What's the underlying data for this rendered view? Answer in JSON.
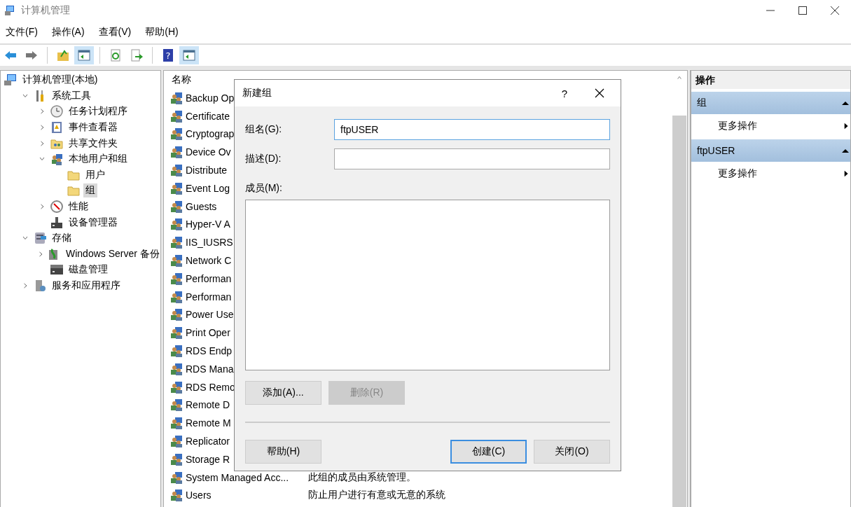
{
  "window": {
    "title": "计算机管理"
  },
  "menu": [
    "文件(F)",
    "操作(A)",
    "查看(V)",
    "帮助(H)"
  ],
  "toolbar": [
    {
      "kind": "back",
      "pressed": false,
      "disabled": false
    },
    {
      "kind": "forward",
      "pressed": false,
      "disabled": true
    },
    {
      "kind": "up",
      "pressed": false,
      "disabled": false
    },
    {
      "kind": "tree",
      "pressed": true,
      "disabled": false
    },
    {
      "kind": "refresh",
      "pressed": false,
      "disabled": false
    },
    {
      "kind": "export",
      "pressed": false,
      "disabled": false
    },
    {
      "kind": "help",
      "pressed": false,
      "disabled": false,
      "glyph": "?"
    },
    {
      "kind": "actions",
      "pressed": true,
      "disabled": false
    }
  ],
  "tree": [
    {
      "label": "计算机管理(本地)",
      "selected": false,
      "children": [
        {
          "label": "系统工具",
          "expanded": true,
          "selected": false,
          "children": [
            {
              "label": "任务计划程序",
              "expanded": false,
              "selected": false
            },
            {
              "label": "事件查看器",
              "expanded": false,
              "selected": false
            },
            {
              "label": "共享文件夹",
              "expanded": false,
              "selected": false
            },
            {
              "label": "本地用户和组",
              "expanded": true,
              "selected": false,
              "children": [
                {
                  "label": "用户",
                  "selected": false
                },
                {
                  "label": "组",
                  "selected": true
                }
              ]
            },
            {
              "label": "性能",
              "expanded": false,
              "selected": false
            },
            {
              "label": "设备管理器",
              "selected": false
            }
          ]
        },
        {
          "label": "存储",
          "expanded": true,
          "selected": false,
          "children": [
            {
              "label": "Windows Server 备份",
              "expanded": false,
              "selected": false
            },
            {
              "label": "磁盘管理",
              "selected": false
            }
          ]
        },
        {
          "label": "服务和应用程序",
          "expanded": false,
          "selected": false
        }
      ]
    }
  ],
  "list": {
    "columns": [
      "名称"
    ],
    "rows": [
      {
        "name": "Backup Op"
      },
      {
        "name": "Certificate"
      },
      {
        "name": "Cryptograp"
      },
      {
        "name": "Device Ov"
      },
      {
        "name": "Distribute"
      },
      {
        "name": "Event Log"
      },
      {
        "name": "Guests"
      },
      {
        "name": "Hyper-V A"
      },
      {
        "name": "IIS_IUSRS"
      },
      {
        "name": "Network C"
      },
      {
        "name": "Performan"
      },
      {
        "name": "Performan"
      },
      {
        "name": "Power Use"
      },
      {
        "name": "Print Oper"
      },
      {
        "name": "RDS Endp"
      },
      {
        "name": "RDS Mana"
      },
      {
        "name": "RDS Remo"
      },
      {
        "name": "Remote D"
      },
      {
        "name": "Remote M"
      },
      {
        "name": "Replicator"
      },
      {
        "name": "Storage R"
      },
      {
        "name": "System Managed Acc...",
        "description": "此组的成员由系统管理。"
      },
      {
        "name": "Users",
        "description": "防止用户进行有意或无意的系统"
      }
    ]
  },
  "actions": [
    {
      "title": "操作",
      "sections": [
        {
          "title": "组",
          "expanded": true,
          "items": [
            "更多操作"
          ]
        },
        {
          "title": "ftpUSER",
          "expanded": true,
          "items": [
            "更多操作"
          ]
        }
      ]
    }
  ],
  "dialog": {
    "title": "新建组",
    "help": "?",
    "fields": [
      {
        "label": "组名(G):",
        "value": "ftpUSER",
        "focused": true
      },
      {
        "label": "描述(D):",
        "focused": false
      }
    ],
    "members_label": "成员(M):",
    "member_buttons": [
      {
        "label": "添加(A)...",
        "disabled": false,
        "default": false
      },
      {
        "label": "删除(R)",
        "disabled": true,
        "default": false
      }
    ],
    "footer_buttons": [
      {
        "label": "帮助(H)",
        "disabled": false,
        "default": false
      },
      {
        "label": "创建(C)",
        "disabled": false,
        "default": true
      },
      {
        "label": "关闭(O)",
        "disabled": false,
        "default": false
      }
    ]
  }
}
